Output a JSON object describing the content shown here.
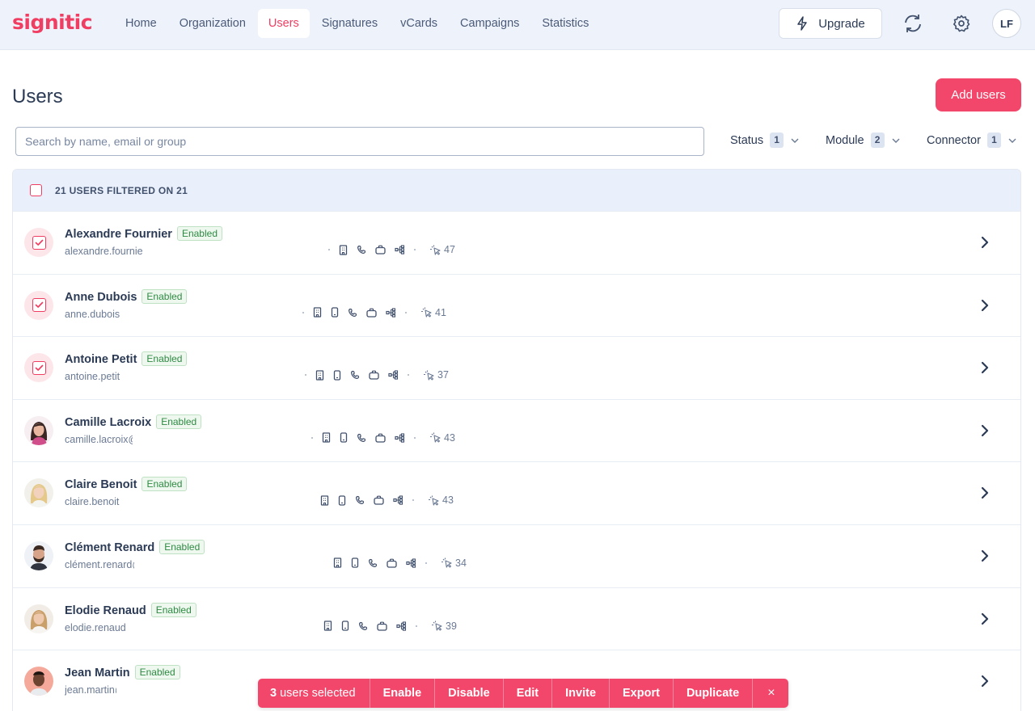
{
  "app": {
    "logo": "signitic"
  },
  "nav": {
    "items": [
      "Home",
      "Organization",
      "Users",
      "Signatures",
      "vCards",
      "Campaigns",
      "Statistics"
    ],
    "active": "Users",
    "upgrade": "Upgrade",
    "user_initials": "LF"
  },
  "page": {
    "title": "Users",
    "add_button": "Add users",
    "search_placeholder": "Search by name, email or group"
  },
  "filters": [
    {
      "label": "Status",
      "count": "1"
    },
    {
      "label": "Module",
      "count": "2"
    },
    {
      "label": "Connector",
      "count": "1"
    }
  ],
  "list": {
    "header": "21 USERS FILTERED ON 21",
    "users": [
      {
        "name": "Alexandre Fournier",
        "status": "Enabled",
        "email": "alexandre.fournier",
        "clicks": "47",
        "selected": true,
        "icons": [
          "building-icon",
          "phone-icon",
          "briefcase-icon",
          "org-tree-icon"
        ]
      },
      {
        "name": "Anne Dubois",
        "status": "Enabled",
        "email": "anne.dubois",
        "clicks": "41",
        "selected": true,
        "icons": [
          "building-icon",
          "mobile-icon",
          "phone-icon",
          "briefcase-icon",
          "org-tree-icon"
        ]
      },
      {
        "name": "Antoine Petit",
        "status": "Enabled",
        "email": "antoine.petit",
        "clicks": "37",
        "selected": true,
        "icons": [
          "building-icon",
          "mobile-icon",
          "phone-icon",
          "briefcase-icon",
          "org-tree-icon"
        ]
      },
      {
        "name": "Camille Lacroix",
        "status": "Enabled",
        "email": "camille.lacroix@",
        "clicks": "43",
        "selected": false,
        "avatar": "woman-dark-hair",
        "icons": [
          "building-icon",
          "mobile-icon",
          "phone-icon",
          "briefcase-icon",
          "org-tree-icon"
        ]
      },
      {
        "name": "Claire Benoit",
        "status": "Enabled",
        "email": "claire.benoit",
        "clicks": "43",
        "selected": false,
        "avatar": "woman-blonde",
        "icons": [
          "building-icon",
          "mobile-icon",
          "phone-icon",
          "briefcase-icon",
          "org-tree-icon"
        ]
      },
      {
        "name": "Clément Renard",
        "status": "Enabled",
        "email": "clément.renard@",
        "clicks": "34",
        "selected": false,
        "avatar": "man-beard",
        "icons": [
          "building-icon",
          "mobile-icon",
          "phone-icon",
          "briefcase-icon",
          "org-tree-icon"
        ]
      },
      {
        "name": "Elodie Renaud",
        "status": "Enabled",
        "email": "elodie.renaud",
        "clicks": "39",
        "selected": false,
        "avatar": "woman-light-hair",
        "icons": [
          "building-icon",
          "mobile-icon",
          "phone-icon",
          "briefcase-icon",
          "org-tree-icon"
        ]
      },
      {
        "name": "Jean Martin",
        "status": "Enabled",
        "email": "jean.martin@",
        "clicks": "",
        "selected": false,
        "avatar": "man-dark-skin",
        "icons": []
      }
    ]
  },
  "bulk_bar": {
    "count": "3",
    "count_label": "users selected",
    "actions": [
      "Enable",
      "Disable",
      "Edit",
      "Invite",
      "Export",
      "Duplicate"
    ],
    "close": "×"
  },
  "colors": {
    "accent": "#f03e62",
    "nav_bg": "#eef3fb",
    "enabled_green": "#2f8a43"
  }
}
